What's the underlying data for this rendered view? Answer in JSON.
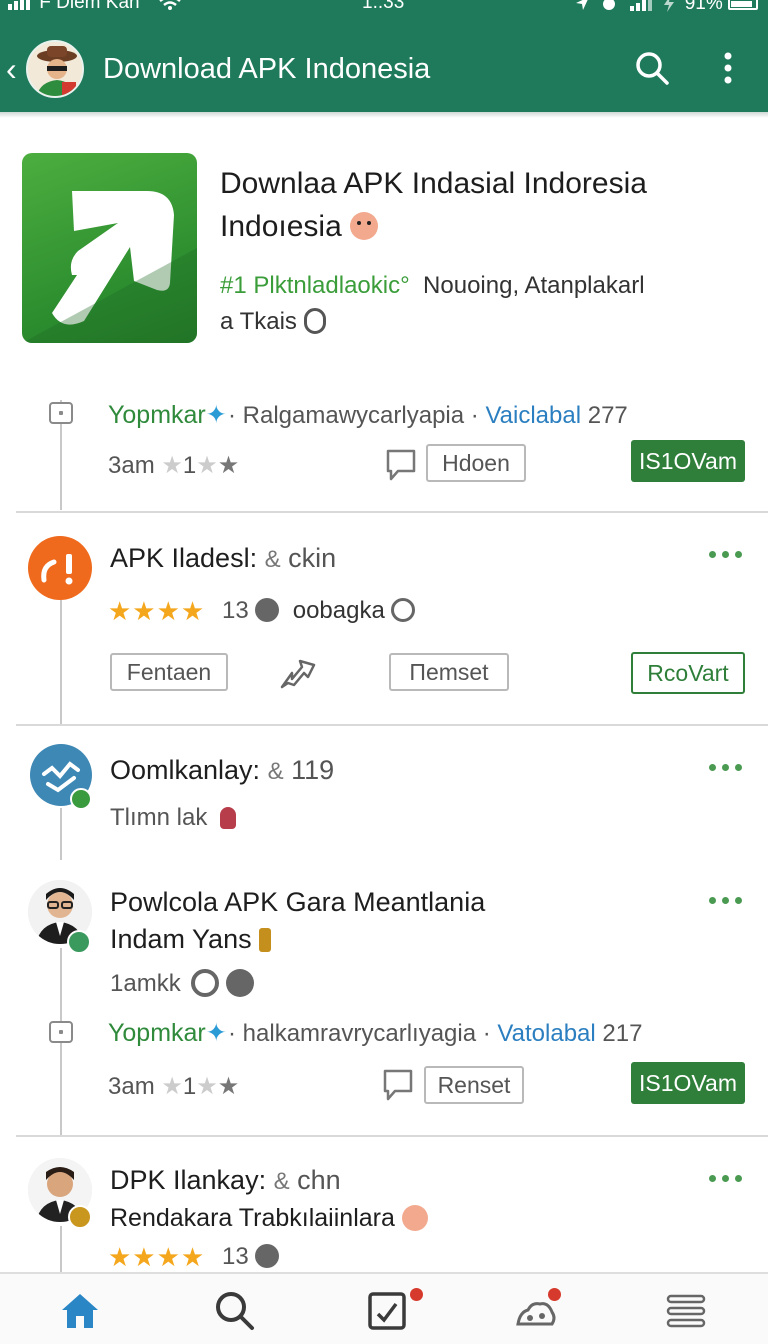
{
  "status_bar": {
    "carrier": "F Diem Kan",
    "time": "1..33",
    "battery": "91%"
  },
  "app_bar": {
    "title": "Download APK Indonesia"
  },
  "hero": {
    "title_line1": "Downlaa APK Indasial Indoresia",
    "title_line2": "Indoıesia",
    "sub_green": "#1 Plktnladlaokic°",
    "sub_rest": "Nouoing,  Atanplakarl",
    "sub_line2": "a Tkais"
  },
  "post1": {
    "author": "Yopmkar",
    "meta": "Ralgamawycarlyapia",
    "meta_tag": "Vaiclabal",
    "meta_count": "277",
    "time": "3am",
    "rating": "1",
    "action_label": "Hdoen",
    "primary_label": "IS1OVam"
  },
  "post2": {
    "title": "APK Iladesl:",
    "title_suffix": "ckin",
    "rating_count": "13",
    "tag": "oobagka",
    "btn_left": "Fentaen",
    "btn_mid": "Пemset",
    "btn_right": "RcoVart"
  },
  "post3": {
    "title": "Oomlkanlay:",
    "count": "119",
    "subtitle": "Tlımn lak"
  },
  "post4": {
    "title_line1": "Powlcola APK Gara Meantlania",
    "title_line2": "Indam Yans",
    "subtitle": "1amkk",
    "author": "Yopmkar",
    "meta": "halkamravrycarlıyagia",
    "meta_tag": "Vatolabal",
    "meta_count": "217",
    "time": "3am",
    "rating": "1",
    "action_label": "Renset",
    "primary_label": "IS1OVam"
  },
  "post5": {
    "title": "DPK Ilankay:",
    "title_suffix": "chn",
    "subtitle": "Rendakara Trabkılaiinlara",
    "rating_count": "13"
  },
  "colors": {
    "brand": "#1f7a5c",
    "accent_green": "#2f7f3a",
    "star": "#f4a71c",
    "link_blue": "#2b7fc0",
    "badge_red": "#d63a2c"
  },
  "bottom_nav": [
    "home-icon",
    "search-icon",
    "checklist-icon",
    "community-icon",
    "menu-list-icon"
  ]
}
